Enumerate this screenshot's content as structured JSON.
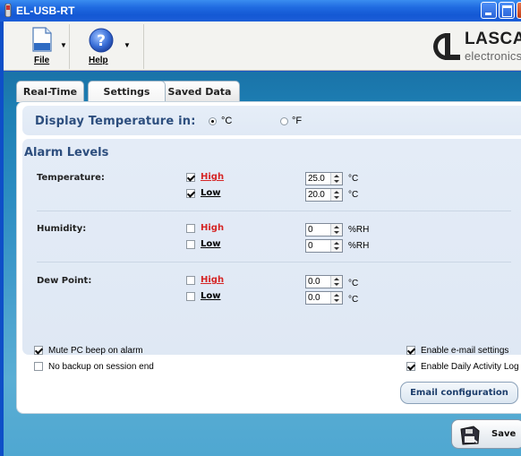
{
  "window": {
    "title": "EL-USB-RT"
  },
  "toolbar": {
    "file_label": "File",
    "help_label": "Help"
  },
  "logo": {
    "brand": "LASCAR",
    "tag": "electronics"
  },
  "tabs": [
    {
      "label": "Real-Time"
    },
    {
      "label": "Settings",
      "active": true
    },
    {
      "label": "Saved Data"
    }
  ],
  "display": {
    "label": "Display Temperature in:",
    "options": [
      {
        "label": "°C",
        "selected": true
      },
      {
        "label": "°F",
        "selected": false
      }
    ]
  },
  "alarms": {
    "title": "Alarm Levels",
    "groups": [
      {
        "name": "Temperature:",
        "high": {
          "label": "High",
          "checked": true,
          "value": "25.0",
          "unit": "°C"
        },
        "low": {
          "label": "Low",
          "checked": true,
          "value": "20.0",
          "unit": "°C"
        }
      },
      {
        "name": "Humidity:",
        "high": {
          "label": "High",
          "checked": false,
          "value": "0",
          "unit": "%RH"
        },
        "low": {
          "label": "Low",
          "checked": false,
          "value": "0",
          "unit": "%RH"
        }
      },
      {
        "name": "Dew Point:",
        "high": {
          "label": "High",
          "checked": false,
          "value": "0.0",
          "unit": "°C"
        },
        "low": {
          "label": "Low",
          "checked": false,
          "value": "0.0",
          "unit": "°C"
        }
      }
    ]
  },
  "options": {
    "mute": {
      "label": "Mute PC beep on alarm",
      "checked": true
    },
    "nobackup": {
      "label": "No backup on session end",
      "checked": false
    },
    "email": {
      "label": "Enable e-mail settings",
      "checked": true
    },
    "daily": {
      "label": "Enable Daily Activity Log",
      "checked": true
    }
  },
  "buttons": {
    "email_config": "Email configuration",
    "save": "Save"
  },
  "colors": {
    "titlebar": "#1f6ae0",
    "accent_text": "#2d4e7e",
    "alarm_red": "#d52626"
  }
}
